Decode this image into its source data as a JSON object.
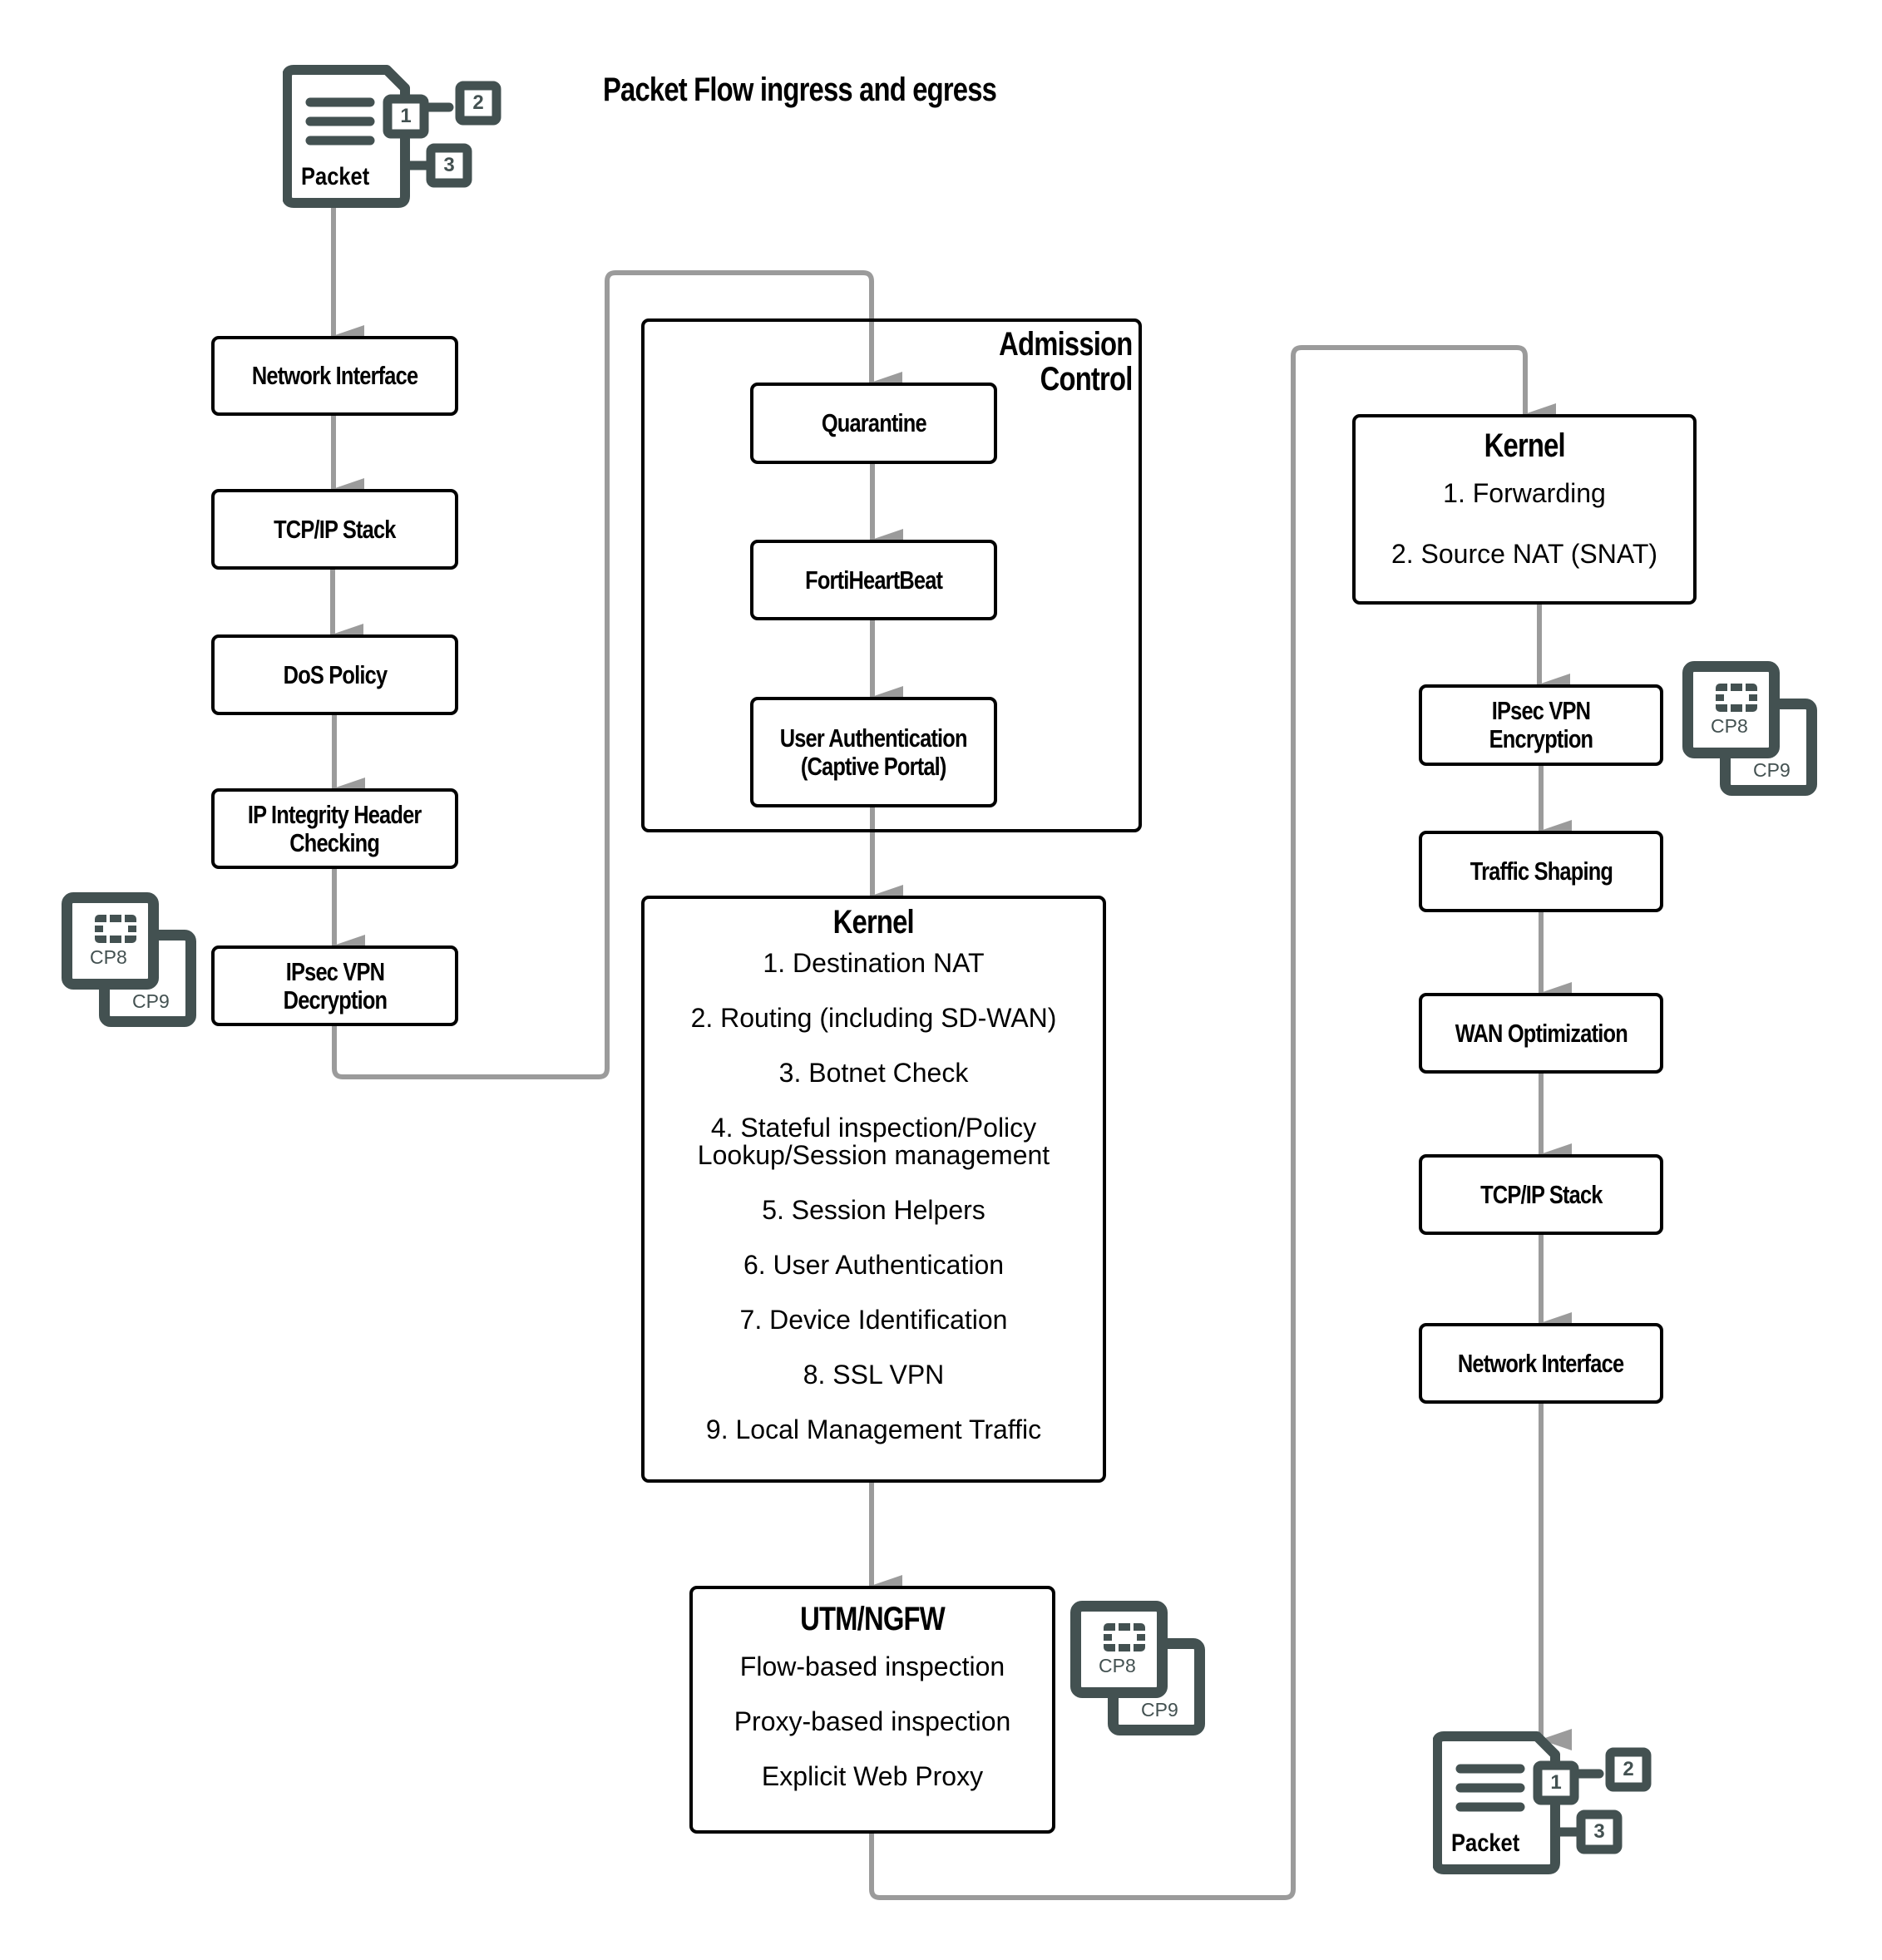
{
  "title": "Packet Flow ingress and egress",
  "colors": {
    "connector": "#9b9b9b",
    "box_border": "#000000",
    "icon": "#435151"
  },
  "packet_in": {
    "label": "Packet",
    "badges": [
      "1",
      "2",
      "3"
    ]
  },
  "packet_out": {
    "label": "Packet",
    "badges": [
      "1",
      "2",
      "3"
    ]
  },
  "ingress": {
    "steps": [
      {
        "label": "Network Interface"
      },
      {
        "label": "TCP/IP Stack"
      },
      {
        "label": "DoS Policy"
      },
      {
        "label": "IP Integrity Header\nChecking"
      },
      {
        "label": "IPsec VPN\nDecryption"
      }
    ]
  },
  "admission_control": {
    "title_line1": "Admission",
    "title_line2": "Control",
    "steps": [
      {
        "label": "Quarantine"
      },
      {
        "label": "FortiHeartBeat"
      },
      {
        "label": "User Authentication\n(Captive Portal)"
      }
    ]
  },
  "kernel_ingress": {
    "title": "Kernel",
    "items": [
      "1. Destination NAT",
      "2. Routing (including SD-WAN)",
      "3. Botnet Check",
      "4. Stateful inspection/Policy\nLookup/Session management",
      "5. Session Helpers",
      "6. User Authentication",
      "7. Device Identification",
      "8. SSL VPN",
      "9. Local Management Traffic"
    ]
  },
  "utm": {
    "title": "UTM/NGFW",
    "items": [
      "Flow-based inspection",
      "Proxy-based inspection",
      "Explicit Web Proxy"
    ]
  },
  "kernel_egress": {
    "title": "Kernel",
    "items": [
      "1. Forwarding",
      "2. Source NAT (SNAT)"
    ]
  },
  "egress": {
    "steps": [
      {
        "label": "IPsec VPN\nEncryption"
      },
      {
        "label": "Traffic Shaping"
      },
      {
        "label": "WAN Optimization"
      },
      {
        "label": "TCP/IP Stack"
      },
      {
        "label": "Network Interface"
      }
    ]
  },
  "accelerators": {
    "front": "CP8",
    "back": "CP9"
  }
}
